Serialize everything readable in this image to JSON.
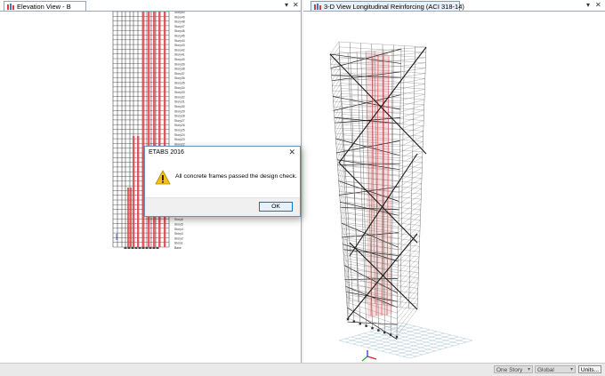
{
  "left_pane": {
    "tab_title": "Elevation View - B",
    "story_labels": [
      "Story50",
      "Story49",
      "Story48",
      "Story47",
      "Story46",
      "Story45",
      "Story44",
      "Story43",
      "Story42",
      "Story41",
      "Story40",
      "Story39",
      "Story38",
      "Story37",
      "Story36",
      "Story35",
      "Story34",
      "Story33",
      "Story32",
      "Story31",
      "Story30",
      "Story29",
      "Story28",
      "Story27",
      "Story26",
      "Story25",
      "Story24",
      "Story23",
      "Story22",
      "Story21",
      "Story20",
      "Story19",
      "Story18",
      "Story17",
      "Story16",
      "Story15",
      "Story14",
      "Story13",
      "Story12",
      "Story11",
      "Story10",
      "Story9",
      "Story8",
      "Story7",
      "Story6",
      "Story5",
      "Story4",
      "Story3",
      "Story2",
      "Story1",
      "Base"
    ]
  },
  "right_pane": {
    "tab_title": "3-D View  Longitudinal Reinforcing  (ACI 318-14)"
  },
  "dialog": {
    "title": "ETABS 2016",
    "message": "All concrete frames passed the design check.",
    "ok_label": "OK"
  },
  "statusbar": {
    "story_select": "One Story",
    "coord_select": "Global",
    "units_label": "Units..."
  },
  "colors": {
    "tab_active": "#e8f1fb",
    "beam_red": "#e0474c",
    "frame_black": "#1a1a1a",
    "warning_yellow": "#f2c21b",
    "ok_border": "#0078d7"
  }
}
